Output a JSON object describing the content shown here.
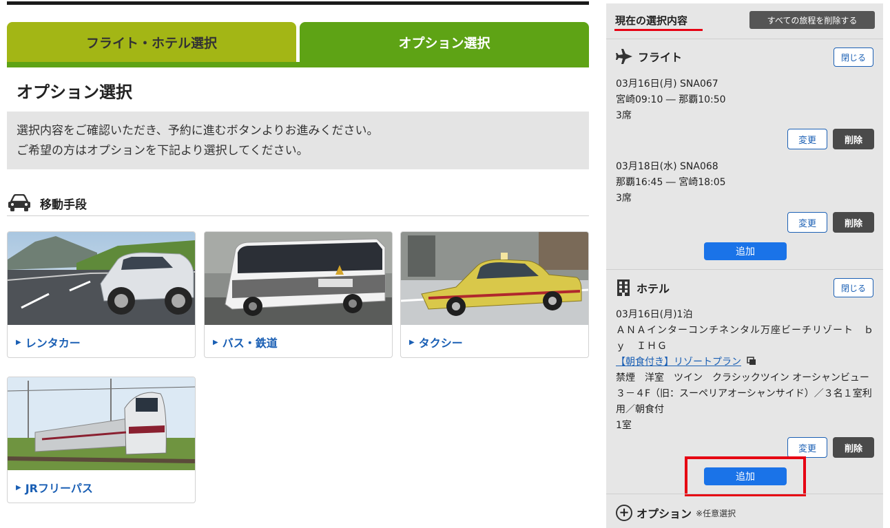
{
  "tabs": {
    "flight_hotel": "フライト・ホテル選択",
    "option": "オプション選択"
  },
  "page_title": "オプション選択",
  "info": {
    "line1": "選択内容をご確認いただき、予約に進むボタンよりお進みください。",
    "line2": "ご希望の方はオプションを下記より選択してください。"
  },
  "transport": {
    "heading": "移動手段",
    "cards": [
      {
        "label": "レンタカー",
        "icon": "car-photo"
      },
      {
        "label": "バス・鉄道",
        "icon": "bus-photo"
      },
      {
        "label": "タクシー",
        "icon": "taxi-photo"
      },
      {
        "label": "JRフリーパス",
        "icon": "train-photo"
      }
    ]
  },
  "sidebar": {
    "title": "現在の選択内容",
    "clear_all": "すべての旅程を削除する",
    "flight": {
      "title": "フライト",
      "close": "閉じる",
      "segments": [
        {
          "date": "03月16日(月) SNA067",
          "route": "宮崎09:10 ― 那覇10:50",
          "seats": "3席"
        },
        {
          "date": "03月18日(水) SNA068",
          "route": "那覇16:45 ― 宮崎18:05",
          "seats": "3席"
        }
      ],
      "change": "変更",
      "delete": "削除",
      "add": "追加"
    },
    "hotel": {
      "title": "ホテル",
      "close": "閉じる",
      "date": "03月16日(月)1泊",
      "name": "ＡＮＡインターコンチネンタル万座ビーチリゾート　ｂｙ　ＩＨＧ",
      "plan": "【朝食付き】リゾートプラン",
      "room": "禁煙　洋室　ツイン　クラシックツイン オーシャンビュー３－４F（旧：スーペリアオーシャンサイド）／３名１室利用／朝食付",
      "rooms": "1室",
      "change": "変更",
      "delete": "削除",
      "add": "追加"
    },
    "option": {
      "title": "オプション",
      "note": "※任意選択"
    }
  },
  "colors": {
    "tab_flight": "#a3b615",
    "tab_option": "#5ea315",
    "link_blue": "#1a5fb4",
    "add_blue": "#1a73e8",
    "highlight_red": "#e60012"
  }
}
